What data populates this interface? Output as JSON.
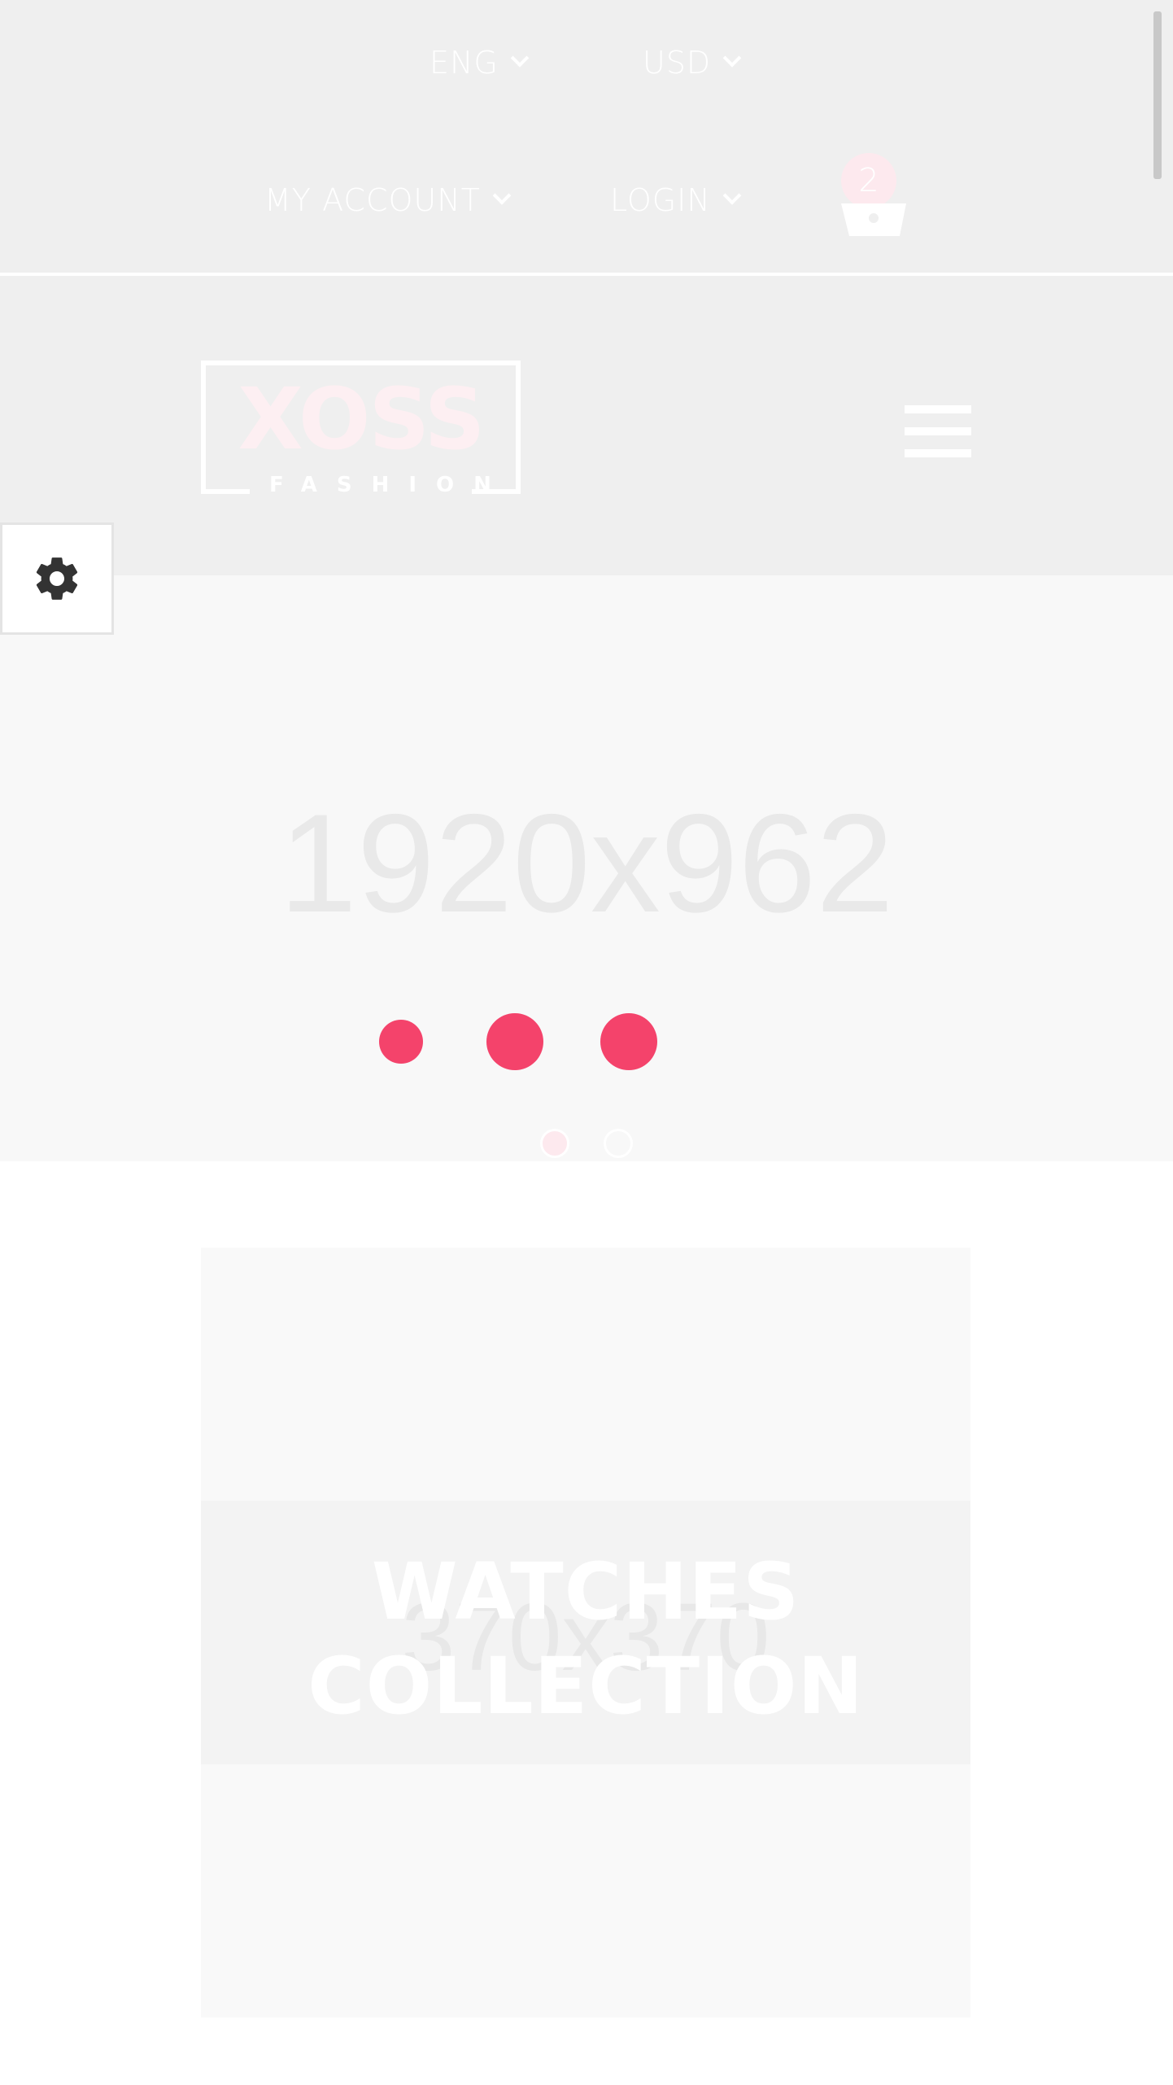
{
  "header": {
    "language": "ENG",
    "currency": "USD",
    "my_account": "MY ACCOUNT",
    "login": "LOGIN",
    "cart_count": "2"
  },
  "brand": {
    "logo_word": "XOSS",
    "logo_sub": "FASHION"
  },
  "hero": {
    "placeholder": "1920x962",
    "loader_color": "#f4436b",
    "slides_total": 2,
    "active_slide": 1
  },
  "collection": {
    "placeholder": "370x370",
    "title_line1": "WATCHES",
    "title_line2": "COLLECTION"
  },
  "icons": {
    "settings": "gear-icon",
    "menu": "hamburger-icon",
    "cart": "basket-icon",
    "dropdown": "chevron-down-icon"
  },
  "colors": {
    "accent": "#f4436b",
    "header_bg": "#efefef",
    "badge_bg": "#fde9ee"
  }
}
